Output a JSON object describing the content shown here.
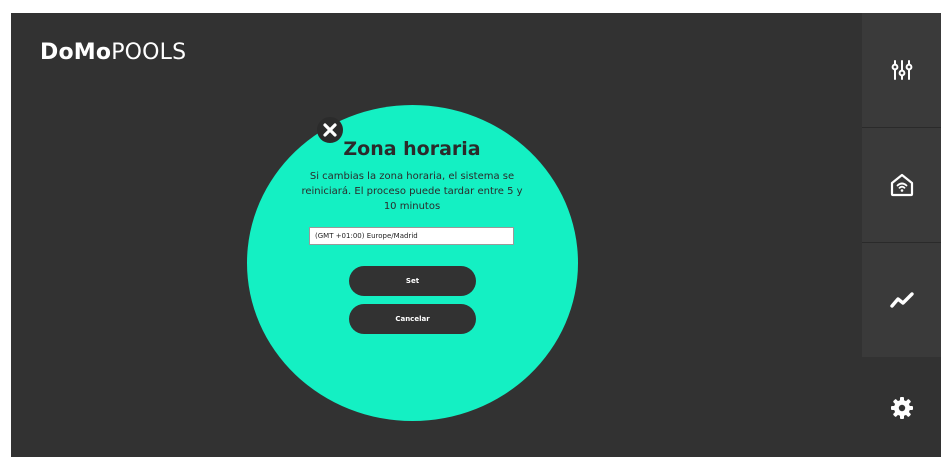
{
  "app": {
    "logo_bold": "DoMo",
    "logo_light": "POOLS"
  },
  "dialog": {
    "title": "Zona horaria",
    "message": "Si cambias la zona horaria, el sistema se reiniciará. El proceso puede tardar entre 5 y 10 minutos",
    "timezone_value": "(GMT +01:00) Europe/Madrid",
    "set_label": "Set",
    "cancel_label": "Cancelar",
    "close_icon": "close-icon"
  },
  "sidebar": {
    "items": [
      {
        "icon": "sliders-icon"
      },
      {
        "icon": "home-wifi-icon"
      },
      {
        "icon": "trend-chart-icon"
      },
      {
        "icon": "gear-icon"
      }
    ]
  },
  "colors": {
    "background": "#323232",
    "accent": "#14f0c3",
    "sidebar_tile": "#3a3a3a",
    "text_dark": "#2b2b2b",
    "button": "#323232"
  }
}
